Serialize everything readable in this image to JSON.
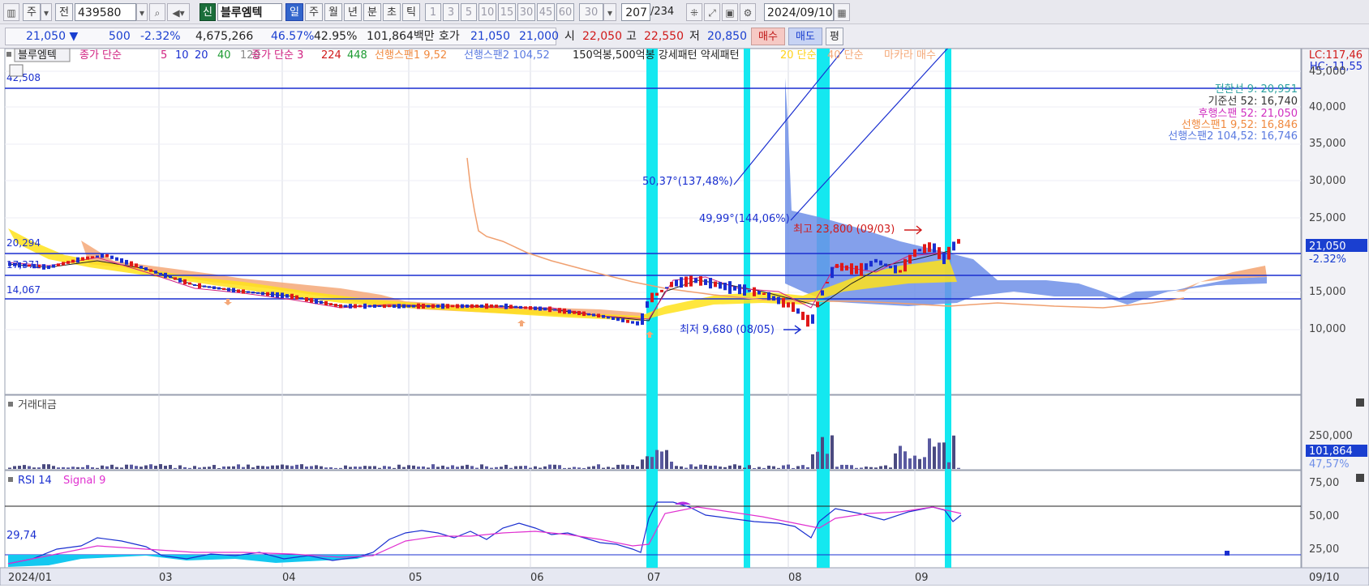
{
  "toolbar": {
    "period_type": "주",
    "prev_label": "전",
    "code": "439580",
    "new_badge": "신",
    "stock_name": "블루엠텍",
    "periods": [
      "일",
      "주",
      "월",
      "년",
      "분",
      "초",
      "틱"
    ],
    "active_period": "일",
    "minute_options": [
      "1",
      "3",
      "5",
      "10",
      "15",
      "30",
      "45",
      "60"
    ],
    "minute_value": "30",
    "count": "207",
    "count_total": "/234",
    "date": "2024/09/10"
  },
  "quote": {
    "price": "21,050",
    "change_arrow": "▼",
    "change": "500",
    "change_pct": "-2.32%",
    "volume": "4,675,266",
    "ratio1": "46.57%",
    "ratio2": "42.95%",
    "amount": "101,864백만",
    "hoga_label": "호가",
    "ask": "21,050",
    "bid": "21,000",
    "open_label": "시",
    "open": "22,050",
    "high_label": "고",
    "high": "22,550",
    "low_label": "저",
    "low": "20,850",
    "buy_label": "매수",
    "sell_label": "매도",
    "eval_label": "평"
  },
  "legend": {
    "name": "블루엠텍",
    "ma_label": "종가 단순",
    "ma_periods": [
      "5",
      "10",
      "20",
      "40",
      "120"
    ],
    "ma2_label": "종가 단순 3",
    "ma2_periods": [
      "224",
      "448"
    ],
    "span1": "선행스팬1 9,52",
    "span2": "선행스팬2 104,52",
    "extra": "150억봉,500억봉 강세패턴  약세패턴",
    "simple20": "20 단순",
    "simple40": "40 단순",
    "macarra": "마카라 매수"
  },
  "right_info": {
    "lc": "LC:117,46",
    "hc": "HC:-11,55",
    "conv": "전환선 9: 20,951",
    "base": "기준선 52: 16,740",
    "lag": "후행스팬 52: 21,050",
    "span1": "선행스팬1 9,52: 16,846",
    "span2": "선행스팬2 104,52: 16,746"
  },
  "price_axis": {
    "ticks": [
      "45,000",
      "40,000",
      "35,000",
      "30,000",
      "25,000",
      "20,000",
      "15,000",
      "10,000"
    ],
    "current": "21,050",
    "current_pct": "-2.32%"
  },
  "hlines": {
    "a": "42,508",
    "b": "20,294",
    "c": "17,371",
    "d": "14,067"
  },
  "annotations": {
    "trend1": "50,37°(137,48%)",
    "trend2": "49,99°(144,06%)",
    "high": "최고 23,800 (09/03)",
    "low": "최저 9,680 (08/05)"
  },
  "volume_panel": {
    "title": "거래대금",
    "tick": "250,000",
    "current": "101,864",
    "pct": "47,57%"
  },
  "rsi_panel": {
    "title": "RSI 14",
    "signal": "Signal 9",
    "level": "29,74",
    "ticks": [
      "75,00",
      "50,00",
      "25,00"
    ]
  },
  "x_axis": {
    "labels": [
      "2024/01",
      "03",
      "04",
      "05",
      "06",
      "07",
      "08",
      "09"
    ],
    "end": "09/10"
  },
  "colors": {
    "cyan": "#14e8f0",
    "up": "#e01818",
    "down": "#1a2fd0",
    "cloud_blue": "#6f8fe8",
    "cloud_orange": "#f4a878",
    "yellow": "#ffe21a"
  }
}
